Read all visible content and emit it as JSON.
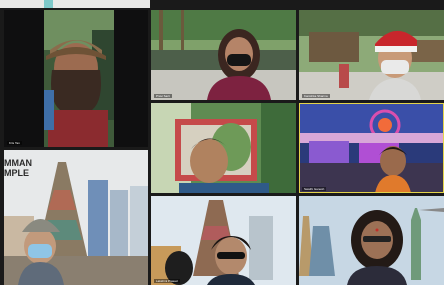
{
  "participants": [
    {
      "name": "Kris Tan",
      "background": "cap-outdoor"
    },
    {
      "name": "Pravi Sarit",
      "background": "garden-walkway"
    },
    {
      "name": "Kanishka Sharma",
      "background": "garden-santa-hat"
    },
    {
      "name": "",
      "background": "leafy-photo"
    },
    {
      "name": "Swathi Ganesh",
      "background": "festive-lights"
    },
    {
      "name": "",
      "background": "temple-city"
    },
    {
      "name": "Lakshmi Prasad",
      "background": "temple-tower-sunglasses"
    },
    {
      "name": "",
      "background": "monuments-collage"
    }
  ],
  "tiles": {
    "t1": {
      "tag": "Kris Tan"
    },
    "t2": {
      "tag": "Pravi Sarit"
    },
    "t3": {
      "tag": "Kanishka Sharma"
    },
    "t5": {
      "tag": "Swathi Ganesh"
    },
    "t7": {
      "tag": "Lakshmi Prasad"
    }
  },
  "temple_caption": {
    "line1": "MMAN",
    "line2": "MPLE"
  },
  "colors": {
    "tile_border": "#1a1a1a",
    "active_speaker": "#e3d44a"
  }
}
